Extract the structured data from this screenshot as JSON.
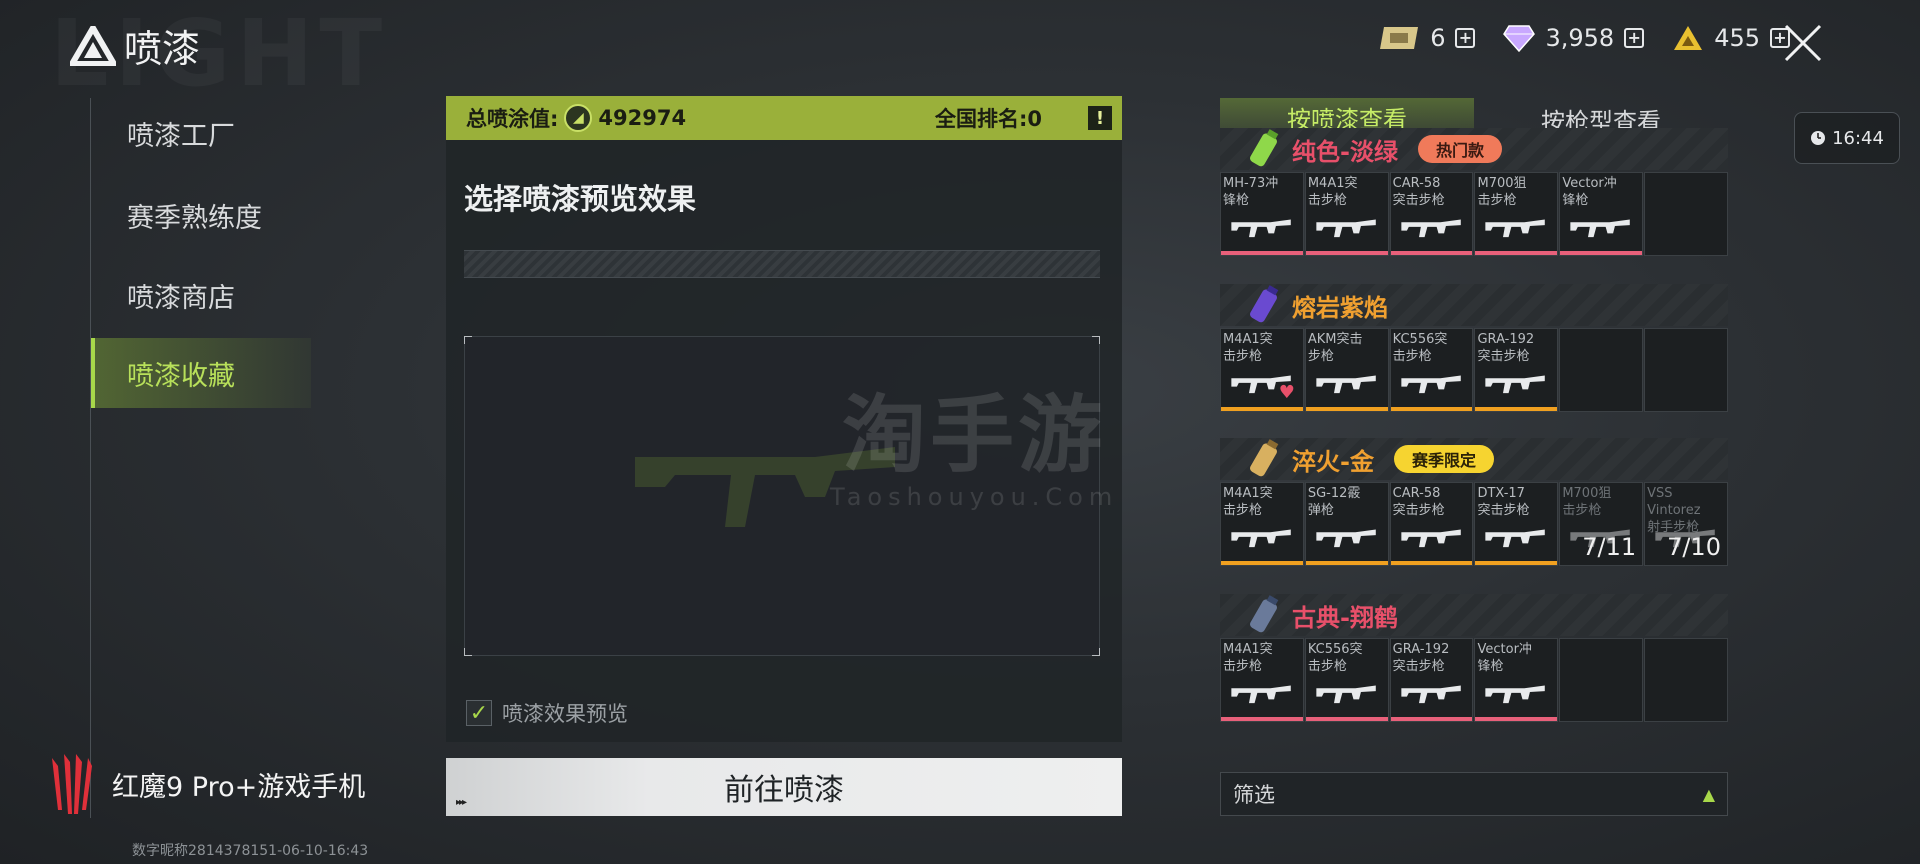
{
  "header": {
    "bg_text": "LIGHT",
    "title": "喷漆",
    "currencies": [
      {
        "icon": "ticket-icon",
        "value": "6"
      },
      {
        "icon": "diamond-icon",
        "value": "3,958"
      },
      {
        "icon": "coin-triangle-icon",
        "value": "455"
      }
    ],
    "plus": "+",
    "clock": "16:44"
  },
  "sidebar": {
    "items": [
      {
        "label": "喷漆工厂",
        "active": false
      },
      {
        "label": "赛季熟练度",
        "active": false
      },
      {
        "label": "喷漆商店",
        "active": false
      },
      {
        "label": "喷漆收藏",
        "active": true
      }
    ]
  },
  "panel": {
    "total_label": "总喷涂值:",
    "total_value": "492974",
    "rank_label": "全国排名:0",
    "alert": "!",
    "title": "选择喷漆预览效果",
    "preview_toggle": "喷漆效果预览",
    "preview_checked": true,
    "check_mark": "✓",
    "goto_button": "前往喷漆",
    "goto_arrows": "▸▸▸"
  },
  "watermark": {
    "main": "淘手游",
    "sub": "Taoshouyou.Com"
  },
  "tabs": [
    {
      "label": "按喷漆查看",
      "active": true
    },
    {
      "label": "按枪型查看",
      "active": false
    }
  ],
  "groups": [
    {
      "name": "纯色-淡绿",
      "name_color": "#e8506a",
      "tag": "热门款",
      "tag_bg": "#f07a5a",
      "tag_color": "#3a1a12",
      "bar_color": "#e8607a",
      "weapons": [
        {
          "label": "MH-73冲锋枪",
          "unlocked": true
        },
        {
          "label": "M4A1突击步枪",
          "unlocked": true
        },
        {
          "label": "CAR-58突击步枪",
          "unlocked": true
        },
        {
          "label": "M700狙击步枪",
          "unlocked": true
        },
        {
          "label": "Vector冲锋枪",
          "unlocked": true
        },
        {
          "label": "",
          "unlocked": false
        }
      ]
    },
    {
      "name": "熔岩紫焰",
      "name_color": "#f0a030",
      "tag": "",
      "bar_color": "#f0a020",
      "weapons": [
        {
          "label": "M4A1突击步枪",
          "unlocked": true,
          "favorite": true
        },
        {
          "label": "AKM突击步枪",
          "unlocked": true
        },
        {
          "label": "KC556突击步枪",
          "unlocked": true
        },
        {
          "label": "GRA-192突击步枪",
          "unlocked": true
        },
        {
          "label": "",
          "unlocked": false
        },
        {
          "label": "",
          "unlocked": false
        }
      ]
    },
    {
      "name": "淬火-金",
      "name_color": "#f0a030",
      "tag": "赛季限定",
      "tag_bg": "#f6d430",
      "tag_color": "#2a2208",
      "bar_color": "#f0a020",
      "weapons": [
        {
          "label": "M4A1突击步枪",
          "unlocked": true
        },
        {
          "label": "SG-12霰弹枪",
          "unlocked": true
        },
        {
          "label": "CAR-58突击步枪",
          "unlocked": true
        },
        {
          "label": "DTX-17突击步枪",
          "unlocked": true
        },
        {
          "label": "M700狙击步枪",
          "unlocked": false,
          "progress": "7/11"
        },
        {
          "label": "VSS Vintorez射手步枪",
          "unlocked": false,
          "progress": "7/10"
        }
      ]
    },
    {
      "name": "古典-翔鹤",
      "name_color": "#e8506a",
      "tag": "",
      "bar_color": "#e8607a",
      "weapons": [
        {
          "label": "M4A1突击步枪",
          "unlocked": true
        },
        {
          "label": "KC556突击步枪",
          "unlocked": true
        },
        {
          "label": "GRA-192突击步枪",
          "unlocked": true
        },
        {
          "label": "Vector冲锋枪",
          "unlocked": true
        },
        {
          "label": "",
          "unlocked": false
        },
        {
          "label": "",
          "unlocked": false
        }
      ]
    }
  ],
  "filter": {
    "label": "筛选",
    "arrow": "▲"
  },
  "brand": {
    "label": "红魔9 Pro+游戏手机",
    "id_line": "数字昵称2814378151-06-10-16:43"
  },
  "colors": {
    "accent": "#a8d84a",
    "header_bar": "#9ab03a"
  }
}
